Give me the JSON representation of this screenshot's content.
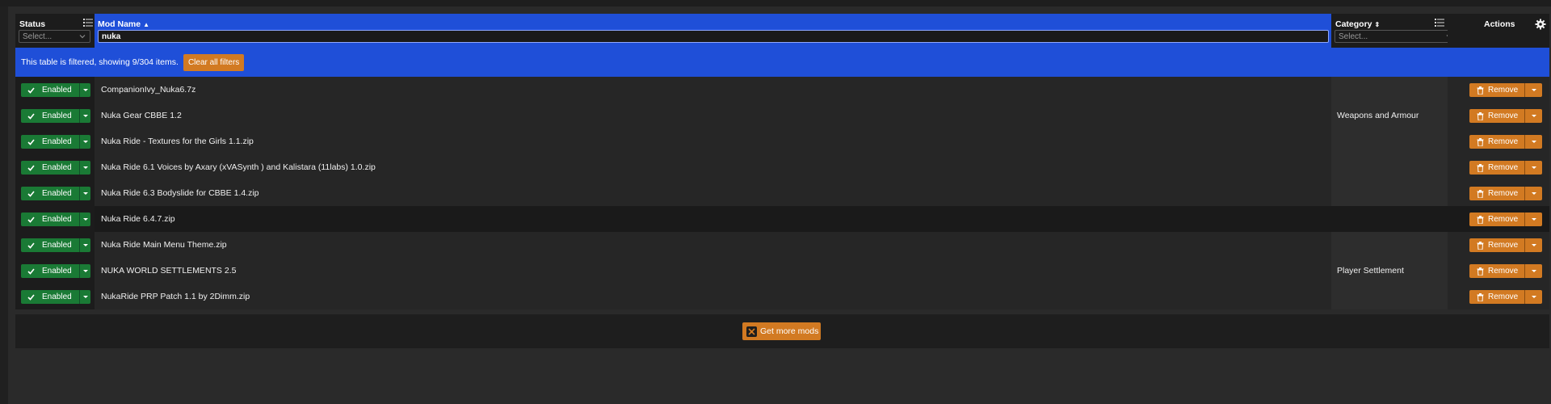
{
  "header": {
    "status_label": "Status",
    "status_placeholder": "Select...",
    "name_label": "Mod Name",
    "name_filter_value": "nuka",
    "category_label": "Category",
    "category_placeholder": "Select...",
    "actions_label": "Actions"
  },
  "banner": {
    "text": "This table is filtered, showing 9/304 items.",
    "clear_label": "Clear all filters"
  },
  "rows": [
    {
      "status": "Enabled",
      "name": "CompanionIvy_Nuka6.7z",
      "action": "Remove"
    },
    {
      "status": "Enabled",
      "name": "Nuka Gear CBBE 1.2",
      "action": "Remove"
    },
    {
      "status": "Enabled",
      "name": "Nuka Ride - Textures for the Girls 1.1.zip",
      "action": "Remove"
    },
    {
      "status": "Enabled",
      "name": "Nuka Ride 6.1 Voices by Axary (xVASynth ) and Kalistara (11labs) 1.0.zip",
      "action": "Remove"
    },
    {
      "status": "Enabled",
      "name": "Nuka Ride 6.3 Bodyslide for CBBE 1.4.zip",
      "action": "Remove"
    },
    {
      "status": "Enabled",
      "name": "Nuka Ride 6.4.7.zip",
      "action": "Remove"
    },
    {
      "status": "Enabled",
      "name": "Nuka Ride Main Menu Theme.zip",
      "action": "Remove"
    },
    {
      "status": "Enabled",
      "name": "NUKA WORLD SETTLEMENTS 2.5",
      "action": "Remove"
    },
    {
      "status": "Enabled",
      "name": "NukaRide PRP Patch 1.1 by 2Dimm.zip",
      "action": "Remove"
    }
  ],
  "category_groups": [
    {
      "label": "Weapons and Armour"
    },
    {
      "label": "Player Settlement"
    }
  ],
  "footer": {
    "get_more_label": "Get more mods"
  },
  "colors": {
    "accent_blue": "#1f4fd8",
    "enabled_green": "#1a7a35",
    "orange": "#d27a22"
  },
  "icons": {
    "status_filter": "list-icon",
    "settings": "gear-icon",
    "enabled": "check-icon",
    "remove": "trash-icon"
  }
}
